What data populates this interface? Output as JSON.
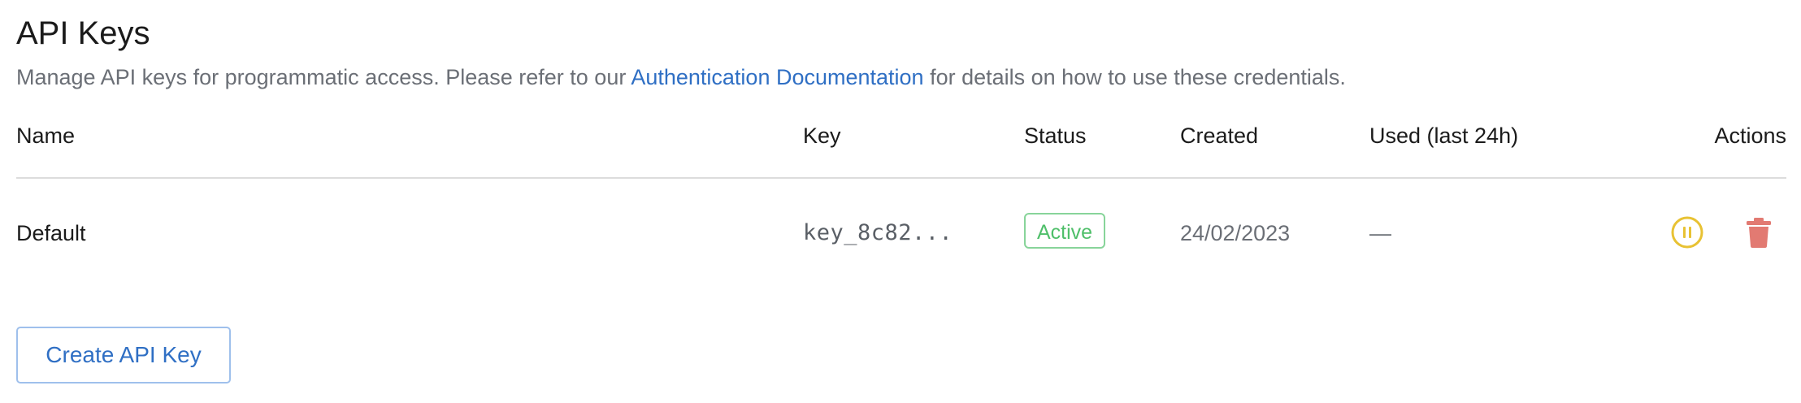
{
  "header": {
    "title": "API Keys",
    "description_before": "Manage API keys for programmatic access. Please refer to our ",
    "docs_link": "Authentication Documentation",
    "description_after": " for details on how to use these credentials."
  },
  "table": {
    "columns": {
      "name": "Name",
      "key": "Key",
      "status": "Status",
      "created": "Created",
      "used": "Used (last 24h)",
      "actions": "Actions"
    },
    "rows": [
      {
        "name": "Default",
        "key": "key_8c82...",
        "status": "Active",
        "created": "24/02/2023",
        "used": "—",
        "actions": {
          "pause_icon": "pause-circle-icon",
          "delete_icon": "trash-icon"
        }
      }
    ]
  },
  "create_button": {
    "label": "Create API Key"
  },
  "colors": {
    "link": "#2f6fc4",
    "status_active": "#4fbf6a",
    "pause_icon": "#e8c233",
    "delete_icon": "#e27a72"
  }
}
